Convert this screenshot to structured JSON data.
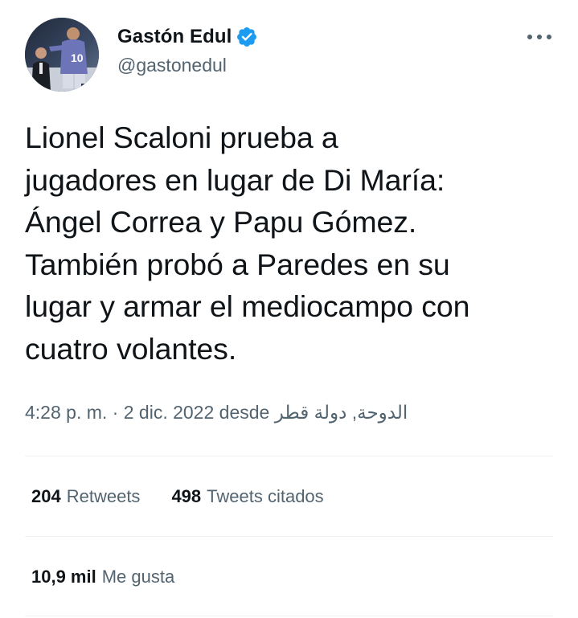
{
  "author": {
    "display_name": "Gastón Edul",
    "handle": "@gastonedul",
    "avatar_icon": "avatar-photo",
    "verified_icon": "verified-badge-icon"
  },
  "menu": {
    "more_icon": "more-options-icon"
  },
  "tweet": {
    "text": "Lionel Scaloni prueba a\njugadores en lugar de Di María:\nÁngel Correa y Papu Gómez.\nTambién probó a Paredes en su\nlugar y armar el mediocampo con\ncuatro volantes."
  },
  "meta": {
    "time": "4:28 p. m.",
    "separator": "·",
    "date": "2 dic. 2022",
    "from_label": "desde",
    "location": "الدوحة, دولة قطر"
  },
  "stats": {
    "retweets_count": "204",
    "retweets_label": "Retweets",
    "quotes_count": "498",
    "quotes_label": "Tweets citados",
    "likes_count": "10,9 mil",
    "likes_label": "Me gusta"
  },
  "colors": {
    "text_primary": "#0f1419",
    "text_secondary": "#536471",
    "verified_blue": "#1d9bf0",
    "divider": "#eff3f4"
  }
}
